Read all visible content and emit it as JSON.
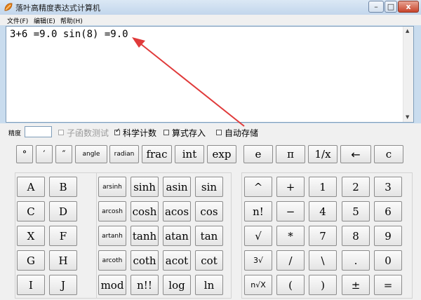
{
  "window": {
    "title": "落叶高精度表达式计算机",
    "minimize": "–",
    "maximize": "□",
    "close": "x"
  },
  "menu": [
    "文件(F)",
    "编辑(E)",
    "帮助(H)"
  ],
  "display": {
    "text": "3+6 =9.0 sin(8) =9.0"
  },
  "scroll": {
    "up": "▲",
    "down": "▼"
  },
  "options": {
    "precision_label": "精度",
    "precision_value": "",
    "subfunc_test": "子函数测试",
    "scientific": "科学计数",
    "formula_store": "算式存入",
    "auto_store": "自动存储",
    "check_mark": "✓"
  },
  "top_row": [
    "°",
    "′",
    "″",
    "angle",
    "radian",
    "frac",
    "int",
    "exp",
    "e",
    "π",
    "1/x",
    "←",
    "c"
  ],
  "letters": [
    [
      "A",
      "B"
    ],
    [
      "C",
      "D"
    ],
    [
      "X",
      "F"
    ],
    [
      "G",
      "H"
    ],
    [
      "I",
      "J"
    ]
  ],
  "functions": [
    [
      "arsinh",
      "sinh",
      "asin",
      "sin"
    ],
    [
      "arcosh",
      "cosh",
      "acos",
      "cos"
    ],
    [
      "artanh",
      "tanh",
      "atan",
      "tan"
    ],
    [
      "arcoth",
      "coth",
      "acot",
      "cot"
    ],
    [
      "mod",
      "n!!",
      "log",
      "ln"
    ]
  ],
  "numpad": [
    [
      "^",
      "+",
      "1",
      "2",
      "3"
    ],
    [
      "n!",
      "−",
      "4",
      "5",
      "6"
    ],
    [
      "√",
      "*",
      "7",
      "8",
      "9"
    ],
    [
      "3√",
      "/",
      "\\",
      ".",
      "0"
    ],
    [
      "n√X",
      "(",
      ")",
      "±",
      "="
    ]
  ],
  "colors": {
    "title_bar": "#c9dcee",
    "close_button": "#c8442b",
    "face": "#f0f0f0"
  }
}
